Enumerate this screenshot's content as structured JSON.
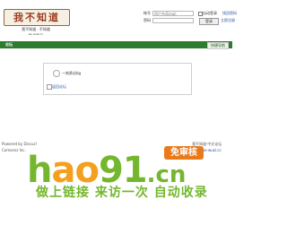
{
  "logo": {
    "title": "我不知道",
    "slogan": "我不知道 · 不知道",
    "domain": "wo-wuzi.cc"
  },
  "login": {
    "account_label": "帐号",
    "account_placeholder": "用户名/Email",
    "password_label": "密码",
    "autologin_label": "自动登录",
    "forgot_label": "找回密码",
    "login_button": "登录",
    "register_label": "立即注册"
  },
  "nav": {
    "item": "论坛",
    "quick": "快捷导航"
  },
  "notice": {
    "message": "一刻贵论bg",
    "back_link": "返回论坛"
  },
  "footer": {
    "left_line1": "Powered by Discuz!",
    "left_line2": "Comsenz Inc.",
    "right_line1": "我不知道·中文论坛",
    "right_line2": "www.wo-wuzi.cc"
  },
  "watermark": {
    "h": "h",
    "ao": "ao",
    "n91": "91",
    "cn": ".cn",
    "badge": "免审核",
    "slogan": "做上链接 来访一次 自动收录"
  }
}
